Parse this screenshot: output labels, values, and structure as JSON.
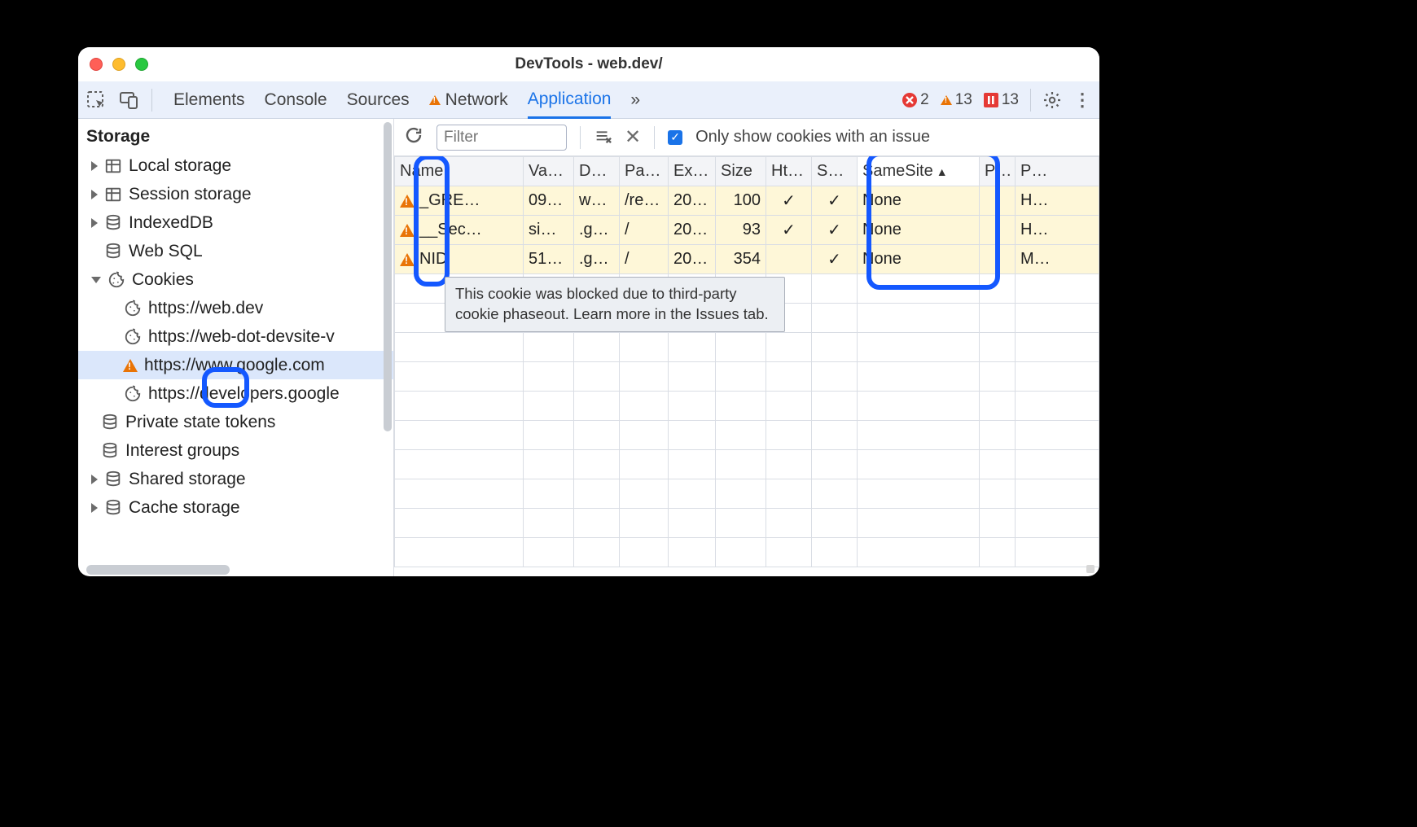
{
  "window": {
    "title": "DevTools - web.dev/"
  },
  "tabstrip": {
    "tabs": [
      "Elements",
      "Console",
      "Sources",
      "Network",
      "Application"
    ],
    "more": "»",
    "status": {
      "errors": 2,
      "warnings": 13,
      "issues": 13
    }
  },
  "sidebar": {
    "title": "Storage",
    "items": {
      "local_storage": "Local storage",
      "session_storage": "Session storage",
      "indexed_db": "IndexedDB",
      "web_sql": "Web SQL",
      "cookies": "Cookies",
      "cookie_children": [
        "https://web.dev",
        "https://web-dot-devsite-v",
        "https://www.google.com",
        "https://developers.google"
      ],
      "private_state_tokens": "Private state tokens",
      "interest_groups": "Interest groups",
      "shared_storage": "Shared storage",
      "cache_storage": "Cache storage"
    }
  },
  "toolbar": {
    "filter_placeholder": "Filter",
    "only_issue_label": "Only show cookies with an issue"
  },
  "table": {
    "headers": {
      "name": "Name",
      "value": "Va…",
      "domain": "D…",
      "path": "Pa…",
      "expires": "Ex…",
      "size": "Size",
      "http": "Ht…",
      "secure": "Se…",
      "samesite": "SameSite",
      "partkey": "P…",
      "priority": "P…"
    },
    "rows": [
      {
        "warn": true,
        "name": "_GRE…",
        "value": "09…",
        "domain": "w…",
        "path": "/re…",
        "expires": "20…",
        "size": "100",
        "http": "✓",
        "secure": "✓",
        "samesite": "None",
        "partkey": "",
        "priority": "H…"
      },
      {
        "warn": true,
        "name": "__Sec…",
        "value": "si…",
        "domain": ".g…",
        "path": "/",
        "expires": "20…",
        "size": "93",
        "http": "✓",
        "secure": "✓",
        "samesite": "None",
        "partkey": "",
        "priority": "H…"
      },
      {
        "warn": true,
        "name": "NID",
        "value": "51…",
        "domain": ".g…",
        "path": "/",
        "expires": "20…",
        "size": "354",
        "http": "",
        "secure": "✓",
        "samesite": "None",
        "partkey": "",
        "priority": "M…"
      }
    ]
  },
  "tooltip": "This cookie was blocked due to third-party cookie phaseout. Learn more in the Issues tab."
}
